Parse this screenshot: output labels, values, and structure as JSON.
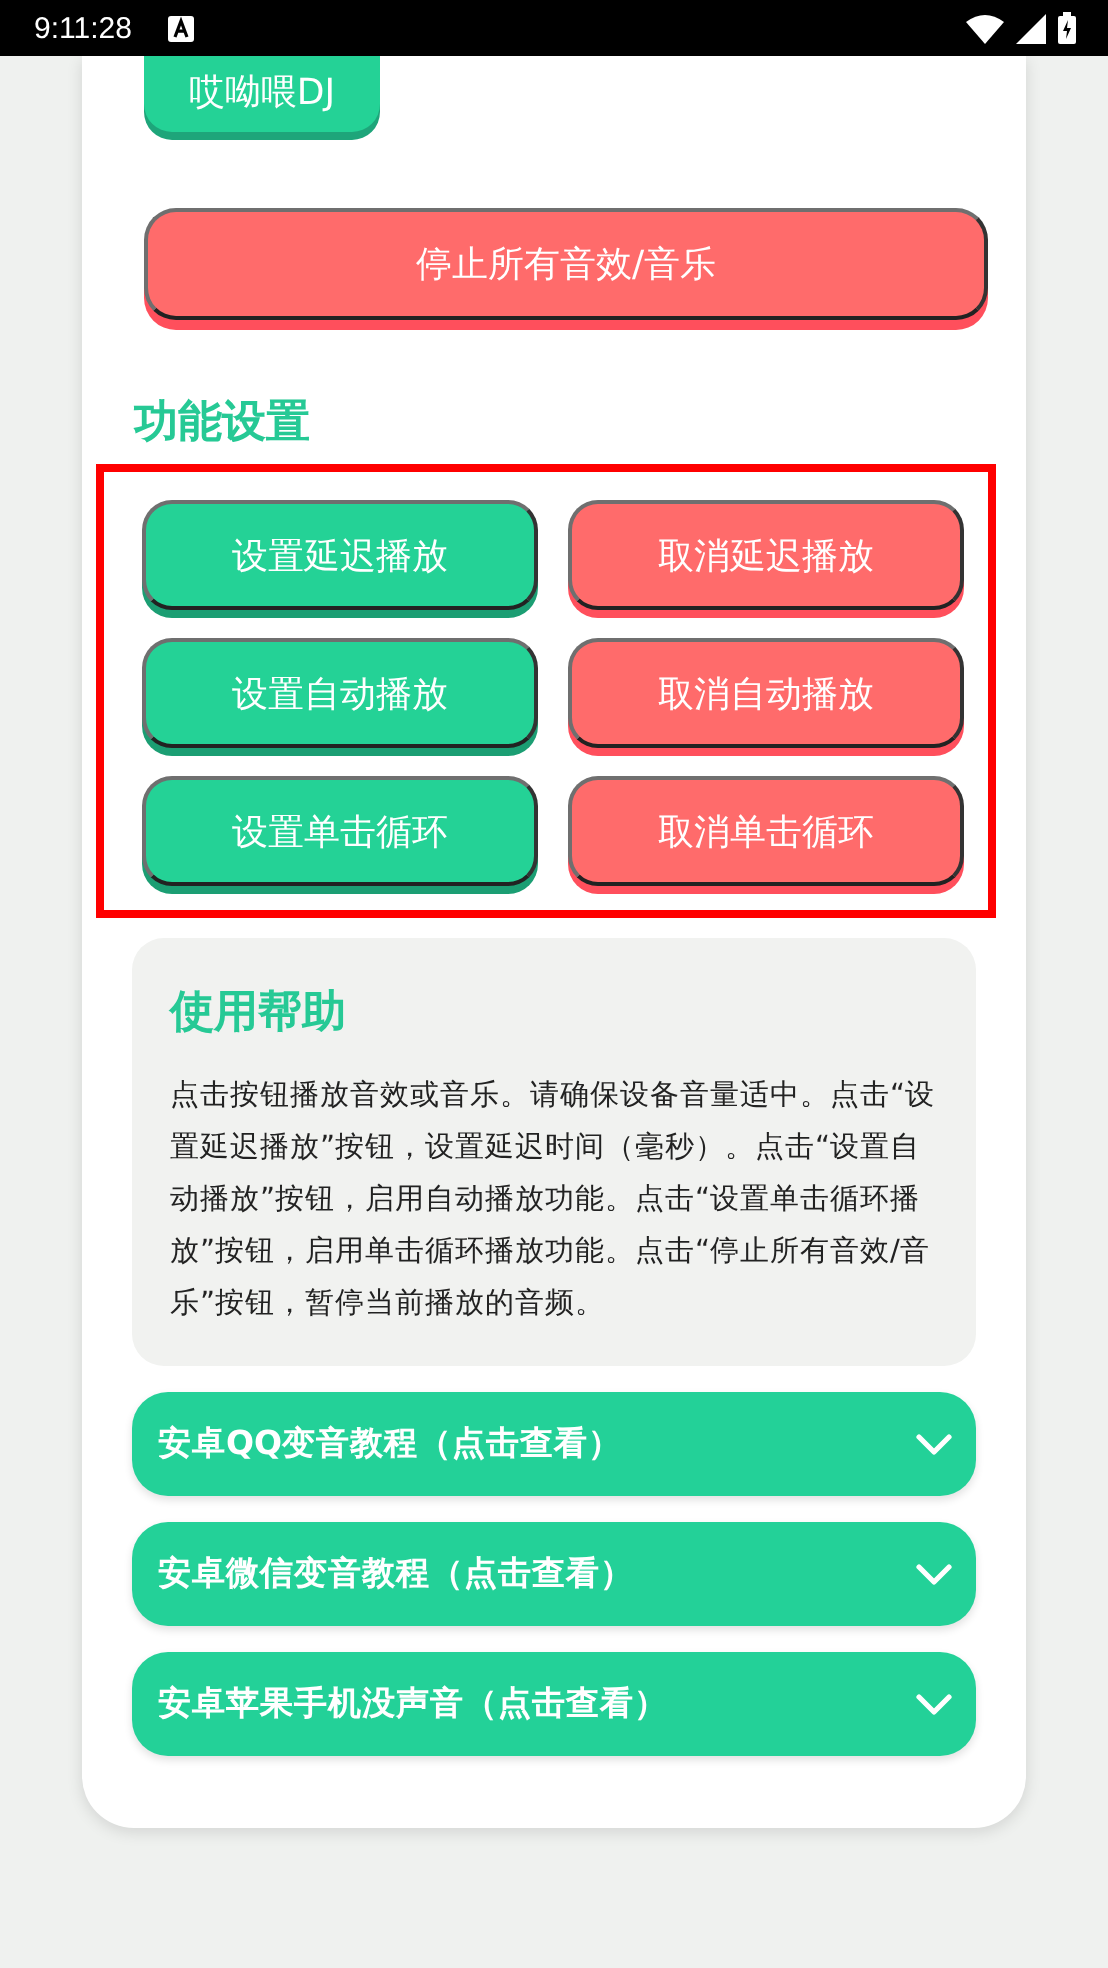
{
  "status_bar": {
    "time": "9:11:28"
  },
  "top_button": {
    "label": "哎呦喂DJ"
  },
  "stop_button": {
    "label": "停止所有音效/音乐"
  },
  "section_title": "功能设置",
  "settings_buttons": [
    {
      "label": "设置延迟播放",
      "kind": "set"
    },
    {
      "label": "取消延迟播放",
      "kind": "cancel"
    },
    {
      "label": "设置自动播放",
      "kind": "set"
    },
    {
      "label": "取消自动播放",
      "kind": "cancel"
    },
    {
      "label": "设置单击循环",
      "kind": "set"
    },
    {
      "label": "取消单击循环",
      "kind": "cancel"
    }
  ],
  "help": {
    "title": "使用帮助",
    "body": "点击按钮播放音效或音乐。请确保设备音量适中。点击“设置延迟播放”按钮，设置延迟时间（毫秒）。点击“设置自动播放”按钮，启用自动播放功能。点击“设置单击循环播放”按钮，启用单击循环播放功能。点击“停止所有音效/音乐”按钮，暂停当前播放的音频。"
  },
  "accordions": [
    {
      "label": "安卓QQ变音教程（点击查看）",
      "expanded": false
    },
    {
      "label": "安卓微信变音教程（点击查看）",
      "expanded": false
    },
    {
      "label": "安卓苹果手机没声音（点击查看）",
      "expanded": false
    }
  ]
}
